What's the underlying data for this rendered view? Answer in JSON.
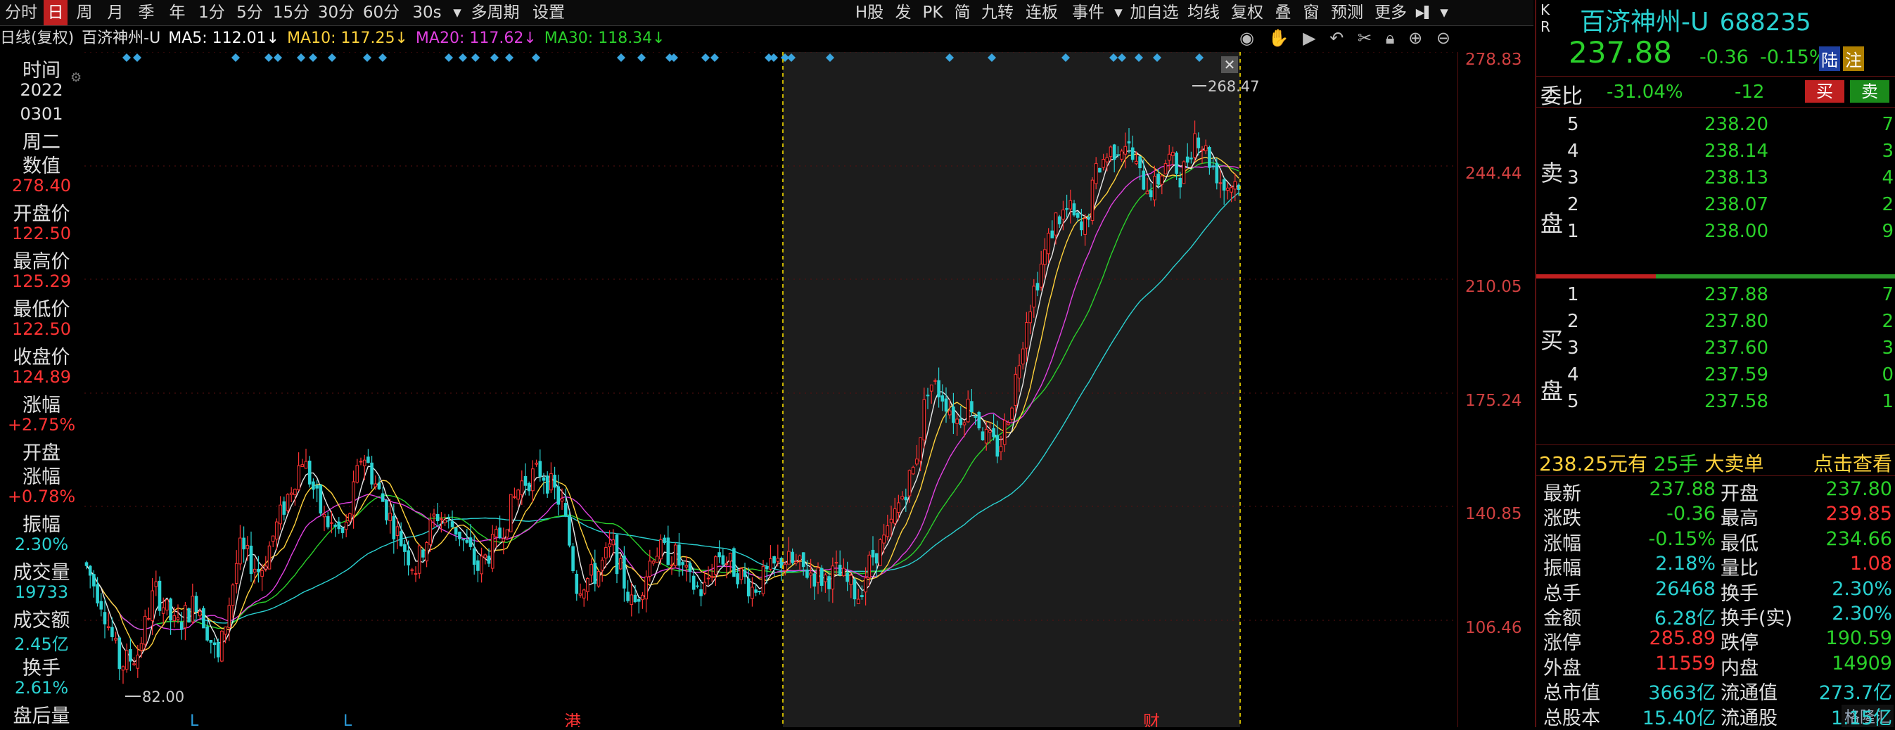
{
  "toolbar": {
    "periods": [
      "分时",
      "日",
      "周",
      "月",
      "季",
      "年",
      "1分",
      "5分",
      "15分",
      "30分",
      "60分",
      "30s"
    ],
    "selected": "日",
    "more_periods": "多周期",
    "settings": "设置",
    "right_items": [
      "H股",
      "发",
      "PK",
      "简",
      "九转",
      "连板",
      "事件",
      "加自选",
      "均线",
      "复权",
      "叠",
      "窗",
      "预测",
      "更多"
    ]
  },
  "legend": {
    "mode": "日线(复权)",
    "stock": "百济神州-U",
    "ma5": "MA5: 112.01↓",
    "ma10": "MA10: 117.25↓",
    "ma20": "MA20: 117.62↓",
    "ma30": "MA30: 118.34↓"
  },
  "info": {
    "time_label": "时间",
    "year": "2022",
    "date": "0301",
    "weekday": "周二",
    "value_label": "数值",
    "value": "278.40",
    "open_label": "开盘价",
    "open": "122.50",
    "high_label": "最高价",
    "high": "125.29",
    "low_label": "最低价",
    "low": "122.50",
    "close_label": "收盘价",
    "close": "124.89",
    "chg_label": "涨幅",
    "chg": "+2.75%",
    "open_chg_label1": "开盘",
    "open_chg_label2": "涨幅",
    "open_chg": "+0.78%",
    "amp_label": "振幅",
    "amp": "2.30%",
    "vol_label": "成交量",
    "vol": "19733",
    "amt_label": "成交额",
    "amt": "2.45亿",
    "turn_label": "换手",
    "turn": "2.61%",
    "after_label": "盘后量"
  },
  "chart_data": {
    "type": "candlestick",
    "yaxis_ticks": [
      "278.83",
      "244.44",
      "210.05",
      "175.24",
      "140.85",
      "106.46"
    ],
    "annotations": {
      "high_marker": "268.47",
      "low_marker": "82.00"
    },
    "event_markers": [
      "港",
      "财"
    ],
    "colors": {
      "up": "#ff3333",
      "down": "#2ad2d2",
      "ma5": "#ffffff",
      "ma10": "#ffd23c",
      "ma20": "#e040e0",
      "ma30": "#2ad02a"
    }
  },
  "right": {
    "market_badge": "K R",
    "name": "百济神州-U",
    "code": "688235",
    "price": "237.88",
    "change": "-0.36",
    "change_pct": "-0.15%",
    "tag1": "陆",
    "tag2": "注",
    "weibi_label": "委比",
    "weibi": "-31.04%",
    "weicha": "-12",
    "buy_btn": "买",
    "sell_btn": "卖",
    "sell_label": [
      "卖",
      "盘"
    ],
    "buy_label": [
      "买",
      "盘"
    ],
    "asks": [
      {
        "lv": "5",
        "price": "238.20",
        "qty": "7"
      },
      {
        "lv": "4",
        "price": "238.14",
        "qty": "3"
      },
      {
        "lv": "3",
        "price": "238.13",
        "qty": "4"
      },
      {
        "lv": "2",
        "price": "238.07",
        "qty": "2"
      },
      {
        "lv": "1",
        "price": "238.00",
        "qty": "9"
      }
    ],
    "bids": [
      {
        "lv": "1",
        "price": "237.88",
        "qty": "7"
      },
      {
        "lv": "2",
        "price": "237.80",
        "qty": "2"
      },
      {
        "lv": "3",
        "price": "237.60",
        "qty": "3"
      },
      {
        "lv": "4",
        "price": "237.59",
        "qty": "0"
      },
      {
        "lv": "5",
        "price": "237.58",
        "qty": "1"
      }
    ],
    "big_order_amount": "238.25元有",
    "big_order_lots": "25手",
    "big_order_text": "大卖单",
    "big_order_link": "点击查看",
    "stats": [
      {
        "k1": "最新",
        "v1": "237.88",
        "c1": "g",
        "k2": "开盘",
        "v2": "237.80",
        "c2": "g"
      },
      {
        "k1": "涨跌",
        "v1": "-0.36",
        "c1": "g",
        "k2": "最高",
        "v2": "239.85",
        "c2": "r"
      },
      {
        "k1": "涨幅",
        "v1": "-0.15%",
        "c1": "g",
        "k2": "最低",
        "v2": "234.66",
        "c2": "g"
      },
      {
        "k1": "振幅",
        "v1": "2.18%",
        "c1": "c",
        "k2": "量比",
        "v2": "1.08",
        "c2": "r"
      },
      {
        "k1": "总手",
        "v1": "26468",
        "c1": "c",
        "k2": "换手",
        "v2": "2.30%",
        "c2": "c"
      },
      {
        "k1": "金额",
        "v1": "6.28亿",
        "c1": "c",
        "k2": "换手(实)",
        "v2": "2.30%",
        "c2": "c"
      },
      {
        "k1": "涨停",
        "v1": "285.89",
        "c1": "r",
        "k2": "跌停",
        "v2": "190.59",
        "c2": "g"
      },
      {
        "k1": "外盘",
        "v1": "11559",
        "c1": "r",
        "k2": "内盘",
        "v2": "14909",
        "c2": "g"
      },
      {
        "k1": "总市值",
        "v1": "3663亿",
        "c1": "c",
        "k2": "流通值",
        "v2": "273.7亿",
        "c2": "c"
      },
      {
        "k1": "总股本",
        "v1": "15.40亿",
        "c1": "c",
        "k2": "流通股",
        "v2": "1.15亿",
        "c2": "c"
      }
    ],
    "watermark": "格隆汇"
  }
}
